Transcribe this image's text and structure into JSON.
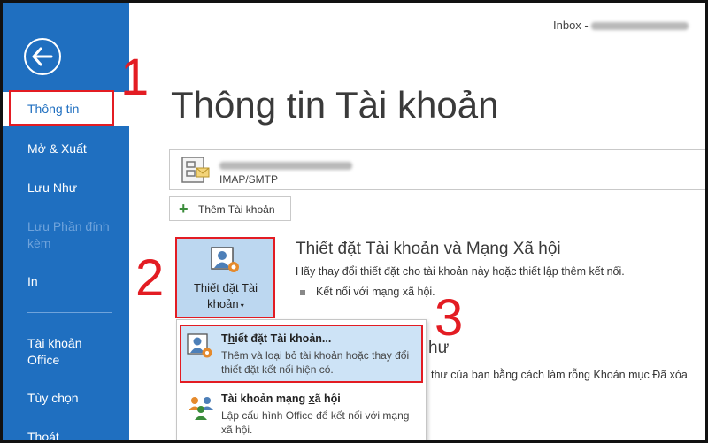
{
  "header": {
    "inbox_label": "Inbox -"
  },
  "sidebar": {
    "items": [
      {
        "label": "Thông tin"
      },
      {
        "label": "Mở & Xuất"
      },
      {
        "label": "Lưu Như"
      },
      {
        "label": "Lưu Phần đính kèm"
      },
      {
        "label": "In"
      },
      {
        "label": "Tài khoản Office"
      },
      {
        "label": "Tùy chọn"
      },
      {
        "label": "Thoát"
      }
    ]
  },
  "main": {
    "title": "Thông tin Tài khoản",
    "account": {
      "type": "IMAP/SMTP"
    },
    "add_account_label": "Thêm Tài khoản",
    "settings_tile": {
      "line1": "Thiết đặt Tài",
      "line2": "khoản"
    },
    "section_title": "Thiết đặt Tài khoản và Mạng Xã hội",
    "section_desc": "Hãy thay đổi thiết đặt cho tài khoản này hoặc thiết lập thêm kết nối.",
    "bullet": "Kết nối với mạng xã hội.",
    "sub_title_tail": "hư",
    "sub_desc_tail": "thư của bạn bằng cách làm rỗng Khoản mục Đã xóa"
  },
  "dropdown": {
    "items": [
      {
        "title_pre": "T",
        "title_u": "h",
        "title_post": "iết đặt Tài khoản...",
        "desc": "Thêm và loại bỏ tài khoản hoặc thay đổi thiết đặt kết nối hiện có."
      },
      {
        "title_pre": "Tài khoản mạng ",
        "title_u": "x",
        "title_post": "ã hội",
        "desc": "Lập cấu hình Office để kết nối với mạng xã hội."
      }
    ]
  },
  "annotations": {
    "step1": "1",
    "step2": "2",
    "step3": "3"
  },
  "colors": {
    "sidebar": "#1f6fc0",
    "annotation": "#e31c23",
    "highlight": "#cde3f6"
  }
}
